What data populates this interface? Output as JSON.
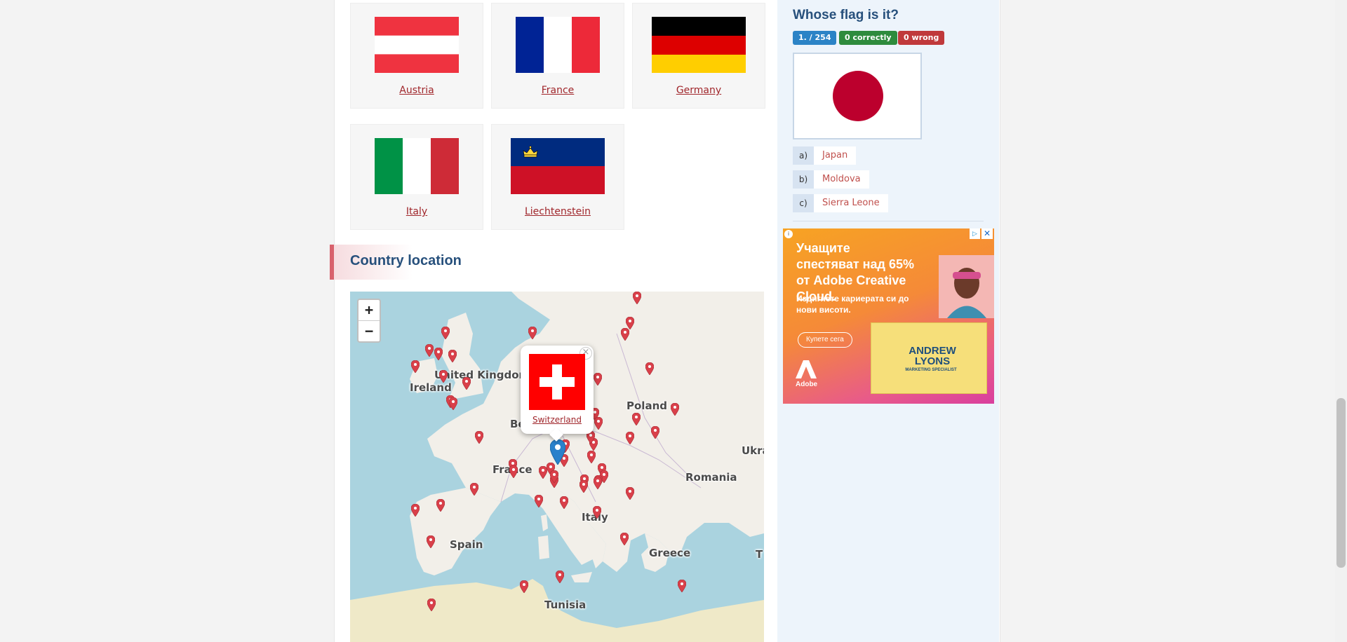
{
  "flags_grid": [
    {
      "name": "Austria"
    },
    {
      "name": "France"
    },
    {
      "name": "Germany"
    },
    {
      "name": "Italy"
    },
    {
      "name": "Liechtenstein"
    }
  ],
  "location_section": {
    "title": "Country location"
  },
  "map": {
    "zoom_in": "+",
    "zoom_out": "−",
    "labels": {
      "united_kingdom": "United Kingdom",
      "ireland": "Ireland",
      "poland": "Poland",
      "france": "France",
      "romania": "Romania",
      "ukraine_partial": "Ukra",
      "italy": "Italy",
      "spain": "Spain",
      "greece": "Greece",
      "tunisia": "Tunisia",
      "belgium_partial": "Be",
      "turkey_partial": "T"
    },
    "popup": {
      "country": "Switzerland",
      "close": "×"
    },
    "colors": {
      "sea": "#aad3df",
      "land": "#f2efe9",
      "marker": "#d9404a",
      "selected_marker": "#2a81cb"
    }
  },
  "quiz": {
    "title": "Whose flag is it?",
    "progress": "1. / 254",
    "correct": "0  correctly",
    "wrong": "0  wrong",
    "answers": [
      {
        "letter": "a)",
        "text": "Japan"
      },
      {
        "letter": "b)",
        "text": "Moldova"
      },
      {
        "letter": "c)",
        "text": "Sierra Leone"
      }
    ],
    "colors": {
      "progress": "#2b83c6",
      "correct": "#2e8b3d",
      "wrong": "#c0393b"
    }
  },
  "ad": {
    "headline": "Учащите спестяват над 65% от Adobe Creative Cloud.",
    "subtext": "Издигнете кариерата си до нови висоти.",
    "cta": "Купете сега",
    "card_name": "ANDREW LYONS",
    "card_role": "MARKETING SPECIALIST",
    "logo_text": "Adobe",
    "close": "✕",
    "info": "▷"
  }
}
